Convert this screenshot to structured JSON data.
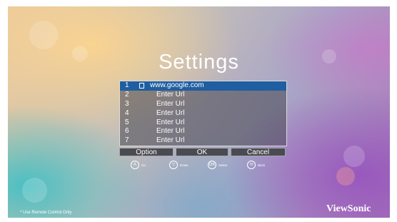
{
  "title": "Settings",
  "url_list": [
    {
      "num": "1",
      "text": "www.google.com",
      "selected": true
    },
    {
      "num": "2",
      "text": "Enter Url",
      "selected": false
    },
    {
      "num": "3",
      "text": "Enter Url",
      "selected": false
    },
    {
      "num": "4",
      "text": "Enter Url",
      "selected": false
    },
    {
      "num": "5",
      "text": "Enter Url",
      "selected": false
    },
    {
      "num": "6",
      "text": "Enter Url",
      "selected": false
    },
    {
      "num": "7",
      "text": "Enter Url",
      "selected": false
    }
  ],
  "buttons": {
    "option": "Option",
    "ok": "OK",
    "cancel": "Cancel"
  },
  "hints": [
    {
      "key": "A",
      "label": "Go"
    },
    {
      "key": "▽",
      "label": "Down"
    },
    {
      "key": "OK",
      "label": "Select"
    },
    {
      "key": "⟲",
      "label": "Back"
    }
  ],
  "footer_note": "* Use Remote Control Only",
  "brand": "ViewSonic"
}
